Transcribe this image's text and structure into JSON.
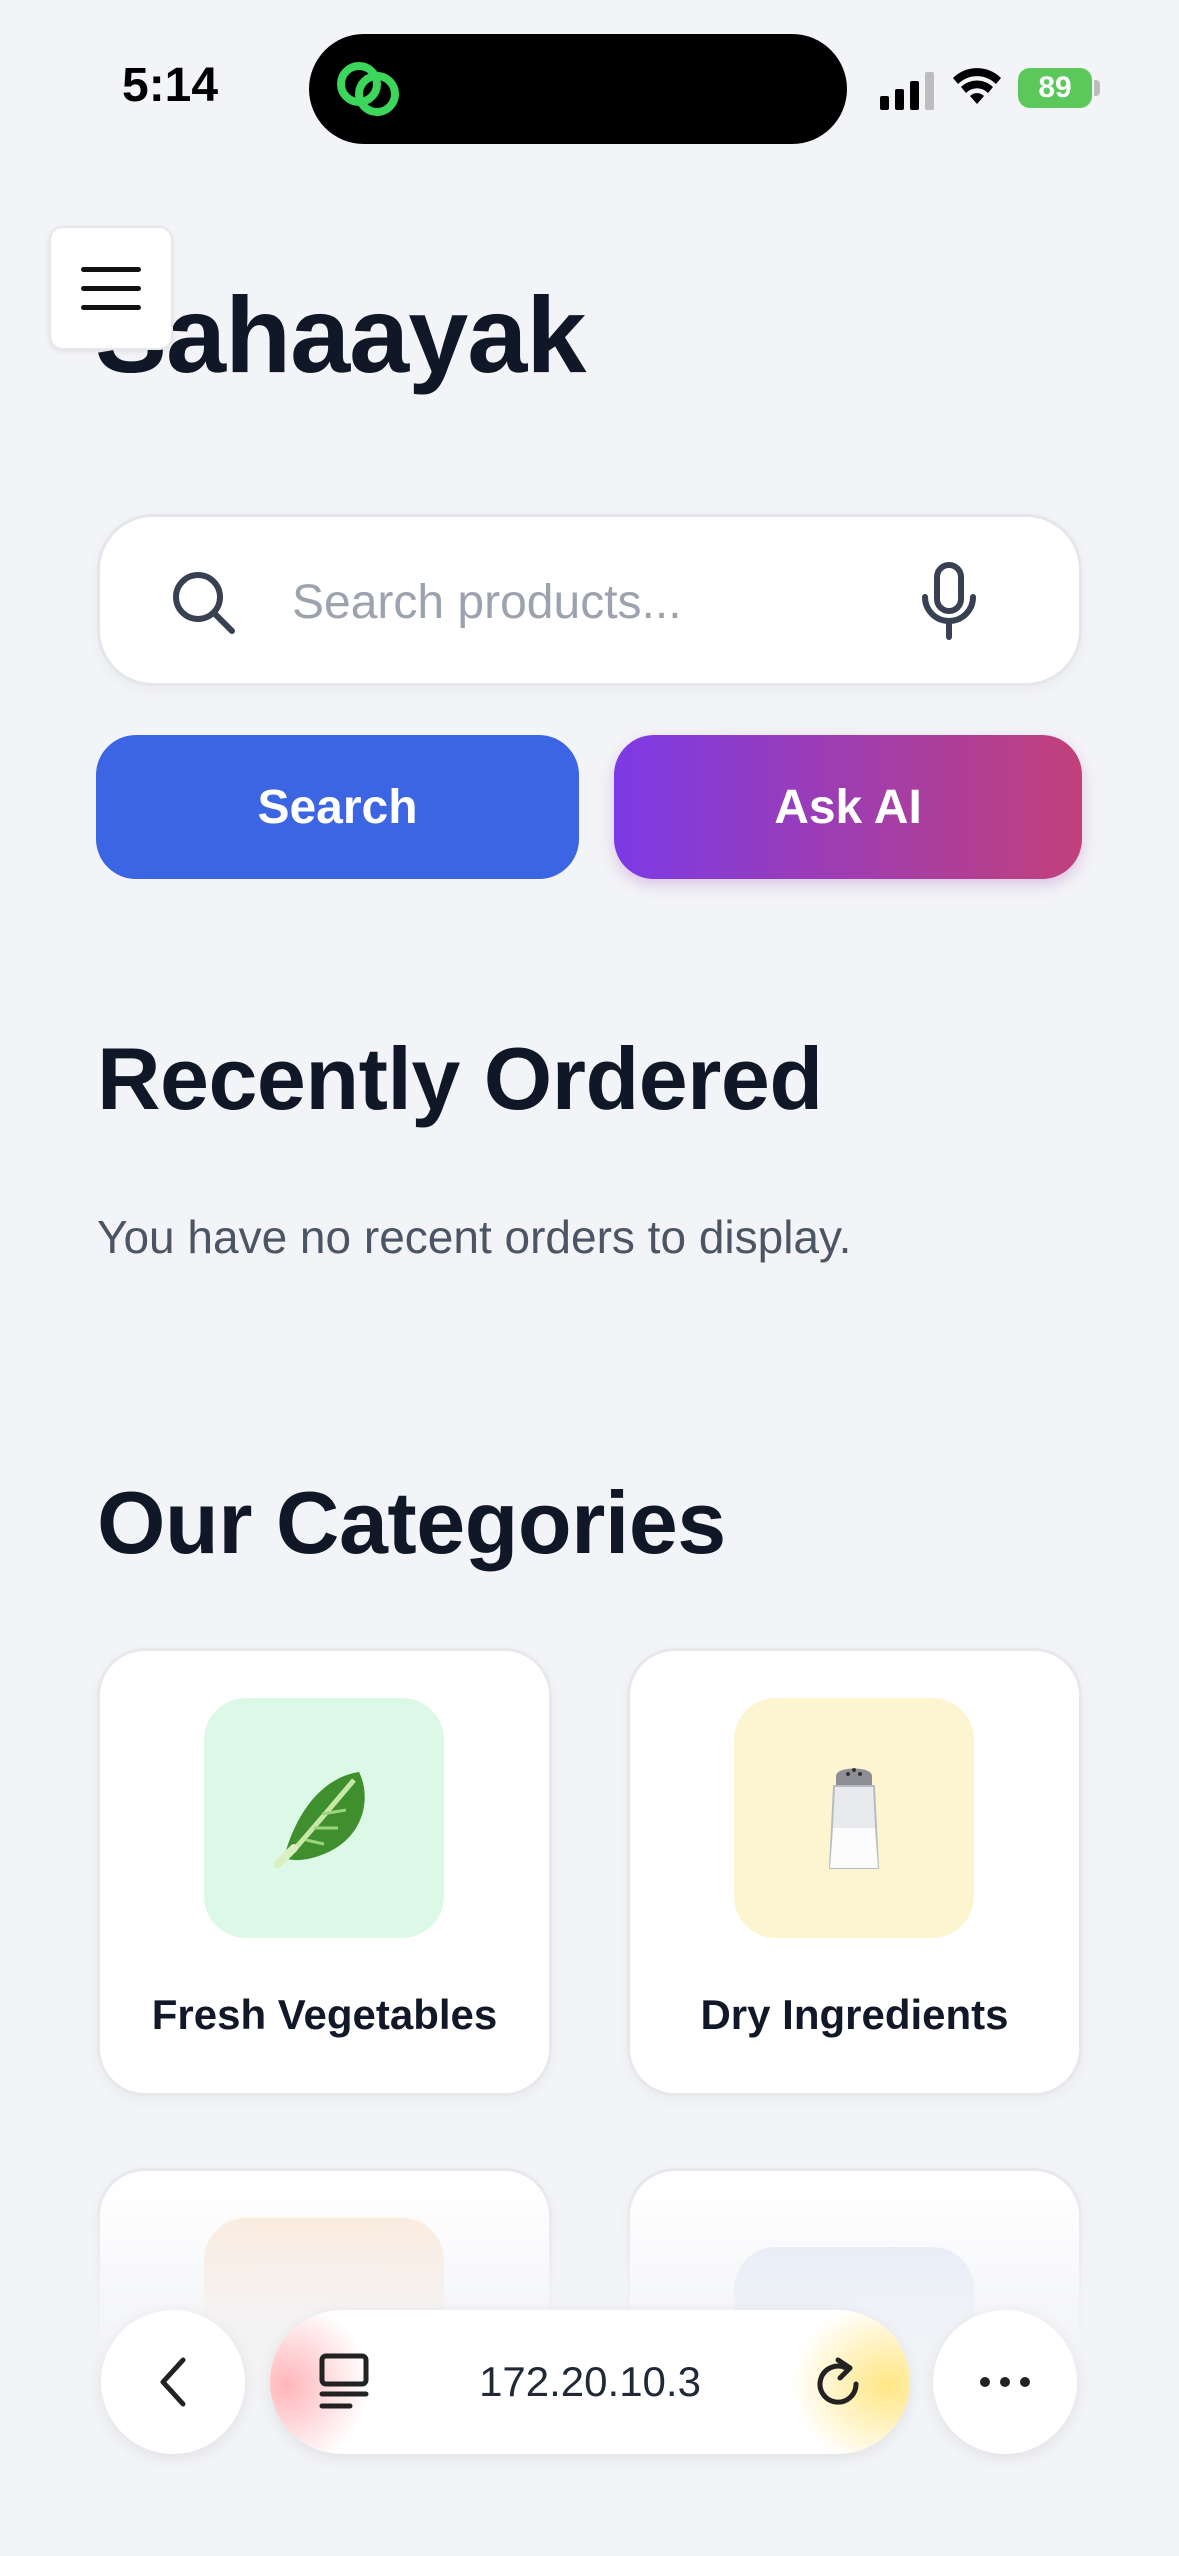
{
  "status_bar": {
    "time": "5:14",
    "battery": "89"
  },
  "header": {
    "title": "Sahaayak",
    "menu_icon": "hamburger-menu-icon"
  },
  "search": {
    "placeholder": "Search products...",
    "value": "",
    "search_button": "Search",
    "ai_button": "Ask AI"
  },
  "recent": {
    "title": "Recently Ordered",
    "empty_message": "You have no recent orders to display."
  },
  "categories": {
    "title": "Our Categories",
    "items": [
      {
        "label": "Fresh Vegetables",
        "icon": "🥬",
        "bg": "#dcf8e6"
      },
      {
        "label": "Dry Ingredients",
        "icon": "🧂",
        "bg": "#fcf5cf"
      },
      {
        "label": "",
        "icon": "🌶",
        "bg": "#fde9d7"
      },
      {
        "label": "",
        "icon": "",
        "bg": "#dfe7f7"
      }
    ]
  },
  "browser": {
    "url": "172.20.10.3"
  },
  "colors": {
    "primary": "#3b65e3",
    "ai_gradient_start": "#7c3ae6",
    "ai_gradient_end": "#c2407a",
    "background": "#f3f4f7"
  }
}
